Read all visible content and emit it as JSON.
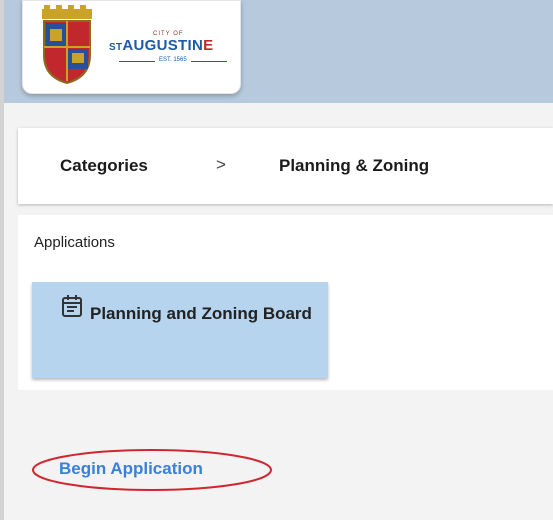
{
  "header": {
    "logo": {
      "city_of": "CITY OF",
      "wordmark_prefix": "ST",
      "wordmark_main": "AUGUSTIN",
      "wordmark_end": "E",
      "established": "EST. 1565"
    }
  },
  "breadcrumb": {
    "items": [
      "Categories",
      "Planning & Zoning"
    ],
    "separator": ">"
  },
  "applications": {
    "label": "Applications",
    "tiles": [
      {
        "title": "Planning and Zoning Board",
        "icon": "calendar-icon"
      }
    ]
  },
  "actions": {
    "begin_label": "Begin Application"
  },
  "colors": {
    "header_bg": "#b6c9dd",
    "tile_bg": "#b6d4ee",
    "link": "#3a7fd8",
    "annotation": "#d0262f"
  }
}
